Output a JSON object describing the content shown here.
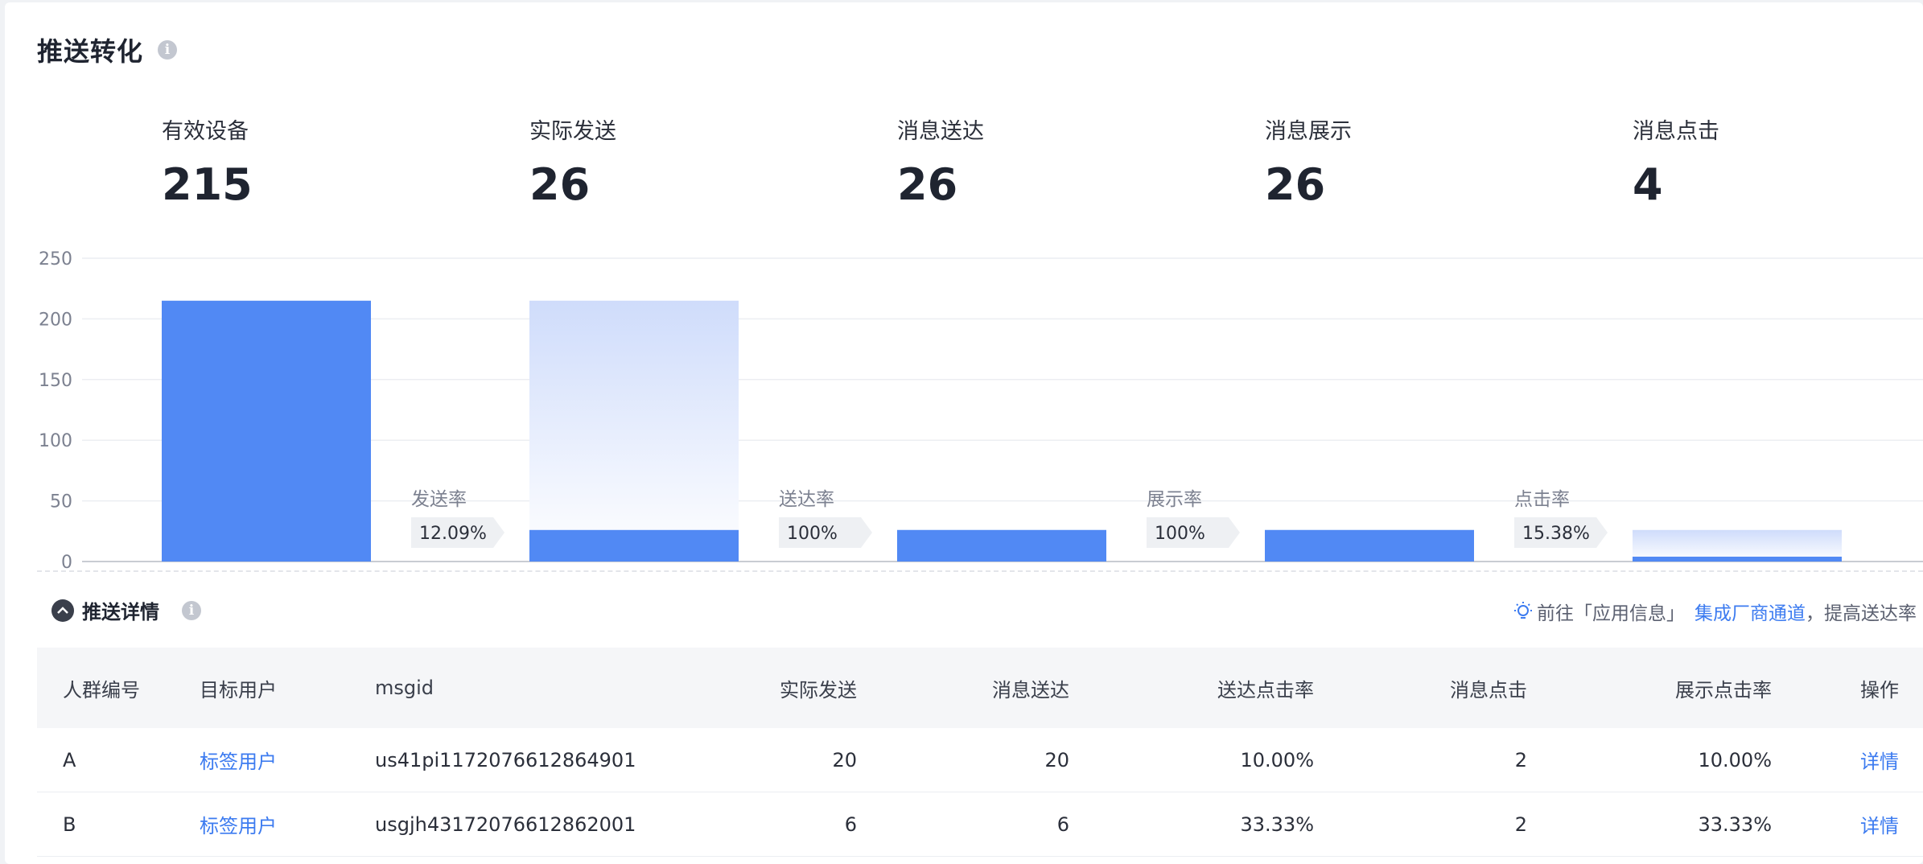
{
  "title": "推送转化",
  "metrics": [
    {
      "label": "有效设备",
      "value": "215"
    },
    {
      "label": "实际发送",
      "value": "26"
    },
    {
      "label": "消息送达",
      "value": "26"
    },
    {
      "label": "消息展示",
      "value": "26"
    },
    {
      "label": "消息点击",
      "value": "4"
    }
  ],
  "chart_data": {
    "type": "bar",
    "categories": [
      "有效设备",
      "实际发送",
      "消息送达",
      "消息展示",
      "消息点击"
    ],
    "values": [
      215,
      26,
      26,
      26,
      4
    ],
    "ylim": [
      0,
      250
    ],
    "yticks": [
      "0",
      "50",
      "100",
      "150",
      "200",
      "250"
    ],
    "grid": true,
    "rates": [
      {
        "label": "发送率",
        "value": "12.09%"
      },
      {
        "label": "送达率",
        "value": "100%"
      },
      {
        "label": "展示率",
        "value": "100%"
      },
      {
        "label": "点击率",
        "value": "15.38%"
      }
    ],
    "colors": {
      "bar": "#5189f4",
      "ghost": "#d4e0fb"
    }
  },
  "details": {
    "title": "推送详情",
    "tip_prefix": "前往「应用信息」",
    "tip_link": "集成厂商通道",
    "tip_suffix": "，提高送达率"
  },
  "table": {
    "headers": [
      "人群编号",
      "目标用户",
      "msgid",
      "实际发送",
      "消息送达",
      "送达点击率",
      "消息点击",
      "展示点击率",
      "操作"
    ],
    "rows": [
      [
        "A",
        "标签用户",
        "us41pi1172076612864901",
        "20",
        "20",
        "10.00%",
        "2",
        "10.00%",
        "详情"
      ],
      [
        "B",
        "标签用户",
        "usgjh43172076612862001",
        "6",
        "6",
        "33.33%",
        "2",
        "33.33%",
        "详情"
      ]
    ]
  }
}
